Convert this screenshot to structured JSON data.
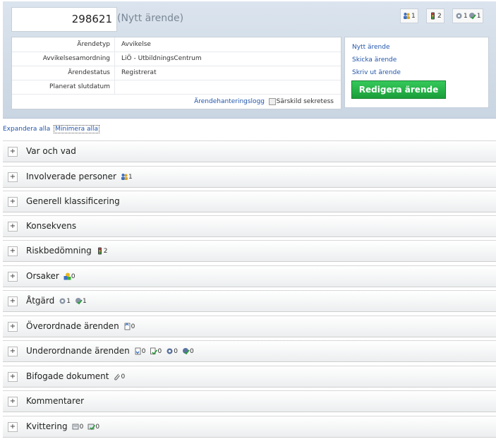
{
  "case": {
    "number": "298621",
    "status_label": "(Nytt ärende)"
  },
  "top_icons": [
    {
      "icon": "people-icon",
      "count": "1"
    },
    {
      "icon": "traffic-light-icon",
      "count": "2"
    },
    {
      "icon": "gears-icon",
      "count": "1",
      "icon2": "gears-check-icon",
      "count2": "1"
    }
  ],
  "info": {
    "rows": [
      {
        "label": "Ärendetyp",
        "value": "Avvikelse"
      },
      {
        "label": "Avvikelsesamordning",
        "value": "LiÖ - UtbildningsCentrum"
      },
      {
        "label": "Ärendestatus",
        "value": "Registrerat"
      },
      {
        "label": "Planerat slutdatum",
        "value": ""
      }
    ],
    "log_link": "Ärendehanteringslogg",
    "secrecy_label": "Särskild sekretess"
  },
  "actions": {
    "new_case": "Nytt ärende",
    "send_case": "Skicka ärende",
    "print_case": "Skriv ut ärende",
    "edit_button": "Redigera ärende"
  },
  "expand_all": "Expandera alla",
  "minimize_all": "Minimera alla",
  "sections": [
    {
      "title": "Var och vad",
      "badges": []
    },
    {
      "title": "Involverade personer",
      "badges": [
        {
          "icon": "people-icon",
          "count": "1"
        }
      ]
    },
    {
      "title": "Generell klassificering",
      "badges": []
    },
    {
      "title": "Konsekvens",
      "badges": []
    },
    {
      "title": "Riskbedömning",
      "badges": [
        {
          "icon": "traffic-light-icon",
          "count": "2"
        }
      ]
    },
    {
      "title": "Orsaker",
      "badges": [
        {
          "icon": "shapes-icon",
          "count": "0"
        }
      ]
    },
    {
      "title": "Åtgärd",
      "badges": [
        {
          "icon": "gears-icon",
          "count": "1"
        },
        {
          "icon": "gears-check-icon",
          "count": "1"
        }
      ]
    },
    {
      "title": "Överordnade ärenden",
      "badges": [
        {
          "icon": "document-up-icon",
          "count": "0"
        }
      ]
    },
    {
      "title": "Underordnande ärenden",
      "badges": [
        {
          "icon": "document-down-icon",
          "count": "0"
        },
        {
          "icon": "document-check-icon",
          "count": "0"
        },
        {
          "icon": "gears-icon",
          "count": "0"
        },
        {
          "icon": "gears-check-icon",
          "count": "0"
        }
      ]
    },
    {
      "title": "Bifogade dokument",
      "badges": [
        {
          "icon": "paperclip-icon",
          "count": "0"
        }
      ]
    },
    {
      "title": "Kommentarer",
      "badges": []
    },
    {
      "title": "Kvittering",
      "badges": [
        {
          "icon": "receipt-icon",
          "count": "0"
        },
        {
          "icon": "receipt-check-icon",
          "count": "0"
        }
      ]
    }
  ]
}
